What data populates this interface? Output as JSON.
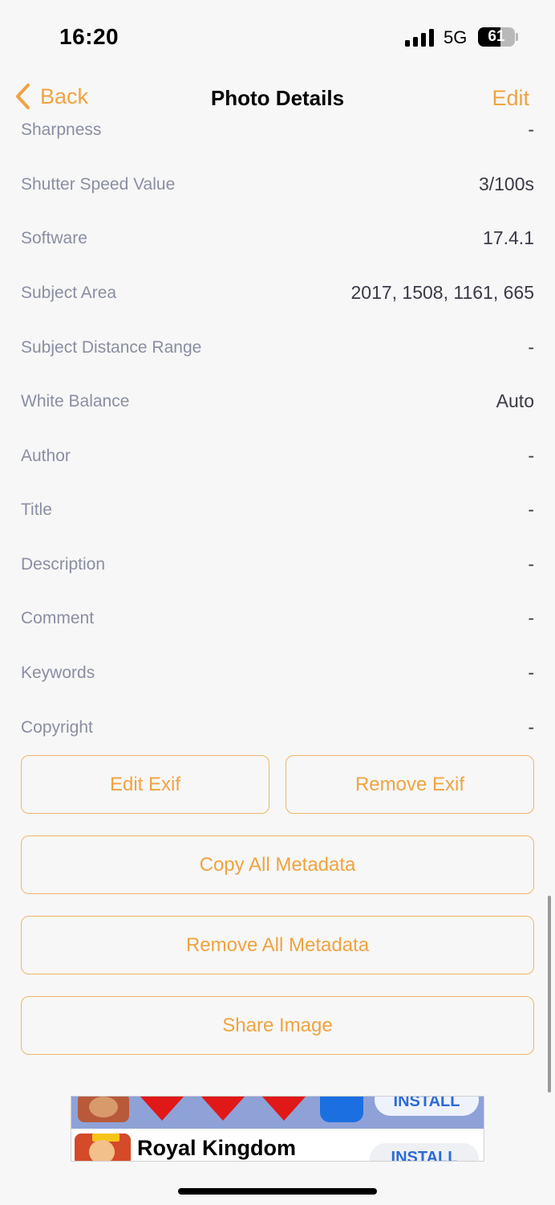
{
  "status": {
    "time": "16:20",
    "network": "5G",
    "battery_level": "61",
    "battery_fraction": 0.61
  },
  "nav": {
    "back_label": "Back",
    "title": "Photo Details",
    "edit_label": "Edit"
  },
  "details": [
    {
      "label": "Sharpness",
      "value": "-"
    },
    {
      "label": "Shutter Speed Value",
      "value": "3/100s"
    },
    {
      "label": "Software",
      "value": "17.4.1"
    },
    {
      "label": "Subject Area",
      "value": "2017, 1508, 1161, 665"
    },
    {
      "label": "Subject Distance Range",
      "value": "-"
    },
    {
      "label": "White Balance",
      "value": "Auto"
    },
    {
      "label": "Author",
      "value": "-"
    },
    {
      "label": "Title",
      "value": "-"
    },
    {
      "label": "Description",
      "value": "-"
    },
    {
      "label": "Comment",
      "value": "-"
    },
    {
      "label": "Keywords",
      "value": "-"
    },
    {
      "label": "Copyright",
      "value": "-"
    }
  ],
  "actions": {
    "edit_exif": "Edit Exif",
    "remove_exif": "Remove Exif",
    "copy_all": "Copy All Metadata",
    "remove_all": "Remove All Metadata",
    "share": "Share Image"
  },
  "ad": {
    "title": "Royal Kingdom",
    "install_label": "INSTALL"
  },
  "colors": {
    "accent": "#f0a340",
    "background": "#f7f7f7",
    "label": "#8a8ea3"
  }
}
